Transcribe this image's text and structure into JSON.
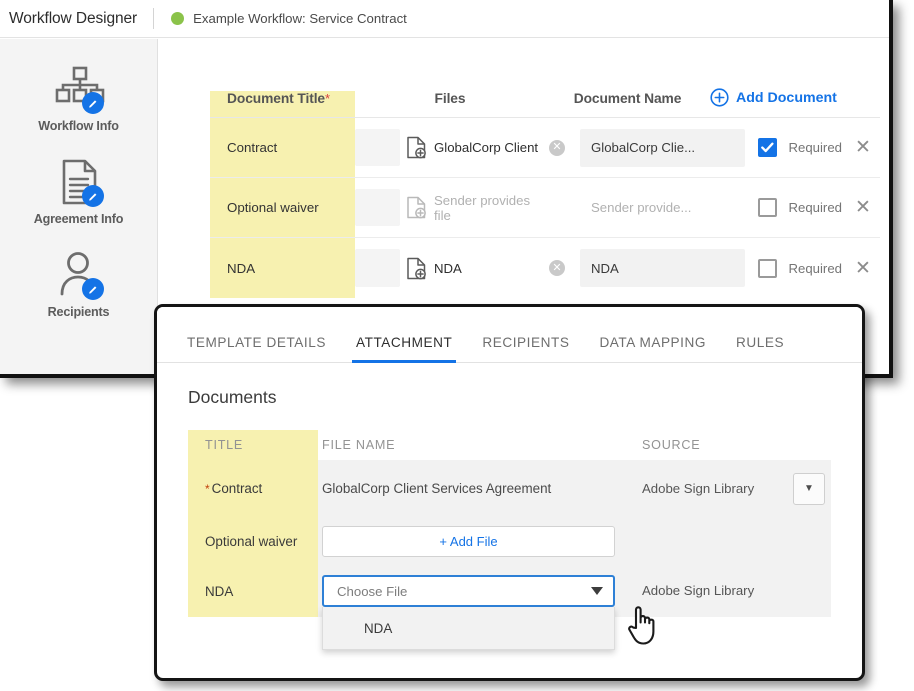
{
  "topbar": {
    "app_title": "Workflow Designer",
    "status_dot_color": "#8bc34a",
    "workflow_name": "Example Workflow: Service Contract"
  },
  "sidebar": {
    "items": [
      {
        "label": "Workflow Info",
        "icon": "workflow-tree-icon"
      },
      {
        "label": "Agreement Info",
        "icon": "document-lines-icon"
      },
      {
        "label": "Recipients",
        "icon": "person-icon"
      }
    ]
  },
  "documents_table": {
    "headers": {
      "title": "Document Title",
      "title_required_marker": "*",
      "files": "Files",
      "document_name": "Document Name"
    },
    "add_document_label": "Add Document",
    "add_document_icon": "plus-circle-icon",
    "required_label": "Required",
    "remove_icon": "close-x-icon",
    "rows": [
      {
        "title": "Contract",
        "file_name": "GlobalCorp Client",
        "file_placeholder": false,
        "has_clear": true,
        "document_name": "GlobalCorp Clie...",
        "document_name_empty": false,
        "required": true
      },
      {
        "title": "Optional waiver",
        "file_name": "Sender provides file",
        "file_placeholder": true,
        "has_clear": false,
        "document_name": "Sender provide...",
        "document_name_empty": true,
        "required": false
      },
      {
        "title": "NDA",
        "file_name": "NDA",
        "file_placeholder": false,
        "has_clear": true,
        "document_name": "NDA",
        "document_name_empty": false,
        "required": false
      }
    ]
  },
  "overlay": {
    "tabs": [
      {
        "label": "TEMPLATE DETAILS",
        "active": false
      },
      {
        "label": "ATTACHMENT",
        "active": true
      },
      {
        "label": "RECIPIENTS",
        "active": false
      },
      {
        "label": "DATA MAPPING",
        "active": false
      },
      {
        "label": "RULES",
        "active": false
      }
    ],
    "heading": "Documents",
    "headers": {
      "title": "TITLE",
      "file_name": "FILE NAME",
      "source": "SOURCE"
    },
    "rows": {
      "contract": {
        "required_marker": "*",
        "title": "Contract",
        "file_name": "GlobalCorp Client Services Agreement",
        "source": "Adobe Sign Library",
        "dropdown_icon": "caret-down-icon"
      },
      "waiver": {
        "title": "Optional waiver",
        "add_file_label": "+ Add File"
      },
      "nda": {
        "title": "NDA",
        "combo_placeholder": "Choose File",
        "combo_caret_icon": "caret-down-icon",
        "source": "Adobe Sign Library",
        "dropdown_options": [
          "NDA"
        ]
      }
    }
  },
  "colors": {
    "accent_blue": "#1473e6",
    "highlight_yellow": "#f7f1b0",
    "status_green": "#8bc34a",
    "required_star_red": "#d94040"
  },
  "cursor": {
    "icon": "pointing-hand-cursor"
  }
}
